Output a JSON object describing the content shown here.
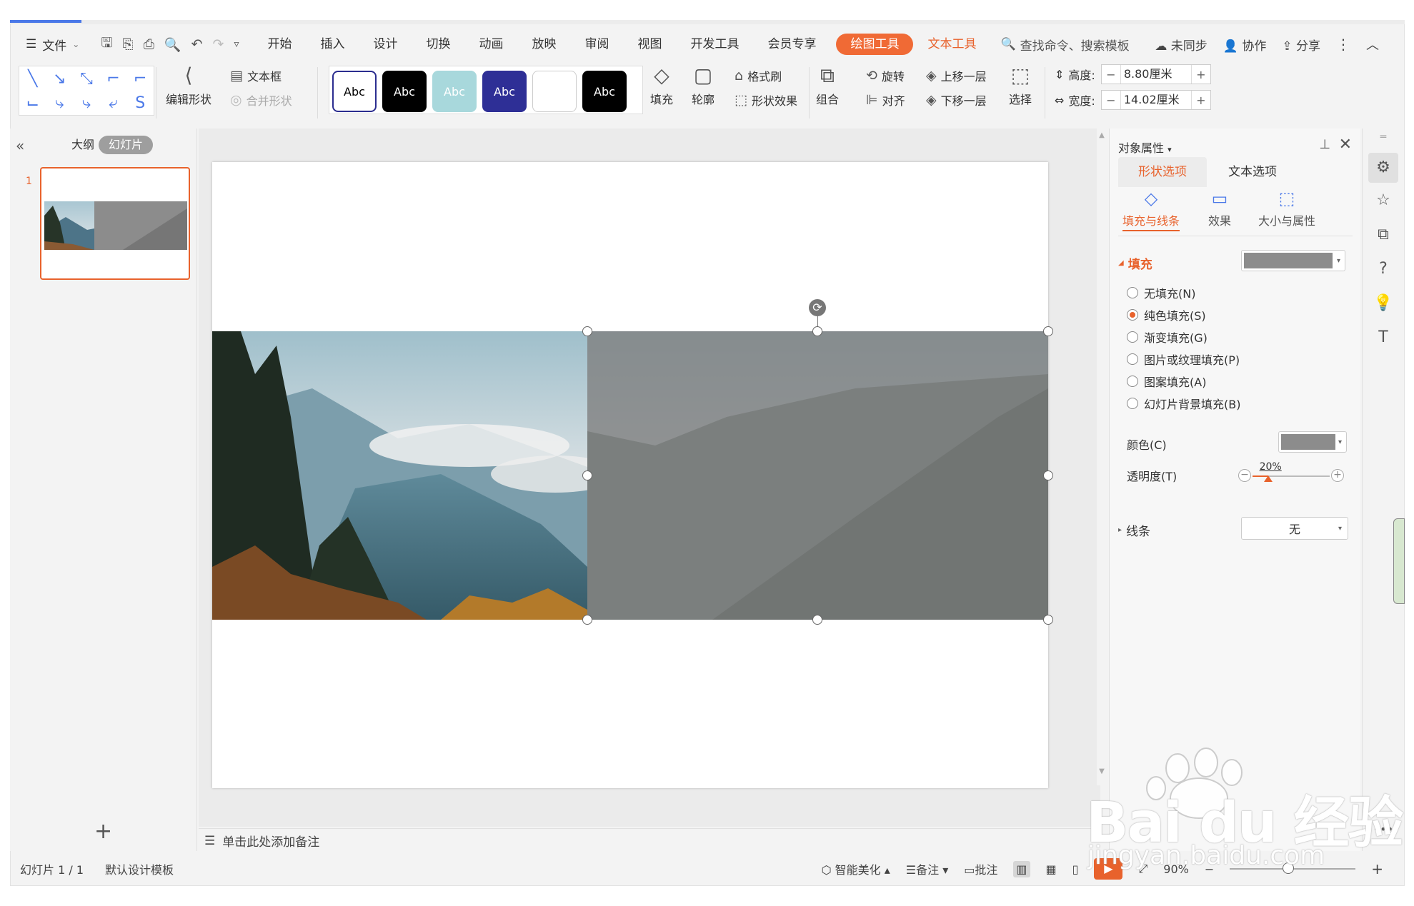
{
  "menu": {
    "file_label": "文件",
    "tabs": [
      "开始",
      "插入",
      "设计",
      "切换",
      "动画",
      "放映",
      "审阅",
      "视图",
      "开发工具",
      "会员专享"
    ],
    "draw_tool_tab": "绘图工具",
    "text_tool_tab": "文本工具",
    "search_label": "查找命令、搜索模板",
    "sync_label": "未同步",
    "collab_label": "协作",
    "share_label": "分享"
  },
  "ribbon": {
    "edit_shape": "编辑形状",
    "textbox": "文本框",
    "merge_shape": "合并形状",
    "style_samples": [
      "Abc",
      "Abc",
      "Abc",
      "Abc",
      "",
      "Abc"
    ],
    "fill": "填充",
    "outline": "轮廓",
    "format_painter": "格式刷",
    "shape_effect": "形状效果",
    "group": "组合",
    "rotate": "旋转",
    "align": "对齐",
    "bring_forward": "上移一层",
    "send_backward": "下移一层",
    "select": "选择",
    "height_label": "高度:",
    "height_value": "8.80厘米",
    "width_label": "宽度:",
    "width_value": "14.02厘米"
  },
  "left_panel": {
    "outline_tab": "大纲",
    "slides_tab": "幻灯片",
    "slide_number": "1"
  },
  "notes_placeholder": "单击此处添加备注",
  "properties": {
    "title": "对象属性",
    "tab_shape": "形状选项",
    "tab_text": "文本选项",
    "sub_fill_line": "填充与线条",
    "sub_effect": "效果",
    "sub_size": "大小与属性",
    "fill_section": "填充",
    "fill_options": [
      "无填充(N)",
      "纯色填充(S)",
      "渐变填充(G)",
      "图片或纹理填充(P)",
      "图案填充(A)",
      "幻灯片背景填充(B)"
    ],
    "fill_selected_index": 1,
    "color_label": "颜色(C)",
    "transparency_label": "透明度(T)",
    "transparency_value": "20%",
    "transparency_fraction": 0.2,
    "line_section": "线条",
    "line_value": "无",
    "fill_color": "#8c8c8c"
  },
  "status": {
    "slide_info": "幻灯片 1 / 1",
    "template": "默认设计模板",
    "beautify": "智能美化",
    "notes": "备注",
    "comments": "批注",
    "zoom": "90%"
  },
  "colors": {
    "accent": "#e8622c",
    "blue": "#4a78e8"
  },
  "watermark": {
    "brand": "Bai du 经验",
    "url": "jingyan.baidu.com"
  }
}
